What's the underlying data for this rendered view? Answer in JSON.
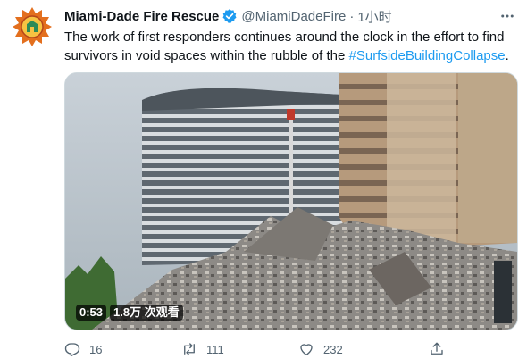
{
  "tweet": {
    "author": {
      "display_name": "Miami-Dade Fire Rescue",
      "handle": "@MiamiDadeFire",
      "verified": true,
      "avatar_icon": "fire-rescue-badge-icon"
    },
    "time": "1小时",
    "text_before": "The work of first responders continues around the clock in the effort to find survivors in void spaces within the rubble of the ",
    "hashtag": "#SurfsideBuildingCollapse",
    "text_after": ".",
    "video": {
      "duration": "0:53",
      "views": "1.8万 次观看"
    },
    "actions": {
      "reply_count": "16",
      "retweet_count": "111",
      "like_count": "232"
    }
  },
  "colors": {
    "accent": "#1d9bf0",
    "secondary_text": "#536471",
    "primary_text": "#0f1419"
  }
}
